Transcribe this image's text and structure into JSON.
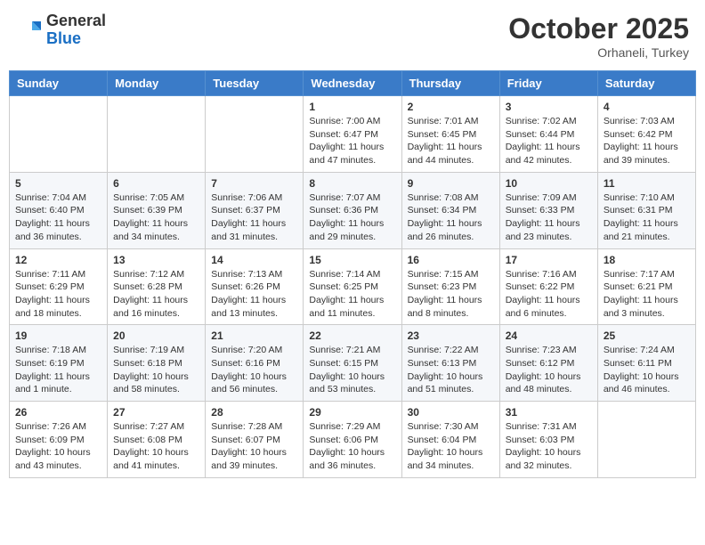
{
  "header": {
    "logo_general": "General",
    "logo_blue": "Blue",
    "month_title": "October 2025",
    "location": "Orhaneli, Turkey"
  },
  "days_of_week": [
    "Sunday",
    "Monday",
    "Tuesday",
    "Wednesday",
    "Thursday",
    "Friday",
    "Saturday"
  ],
  "weeks": [
    [
      {
        "day": "",
        "info": ""
      },
      {
        "day": "",
        "info": ""
      },
      {
        "day": "",
        "info": ""
      },
      {
        "day": "1",
        "info": "Sunrise: 7:00 AM\nSunset: 6:47 PM\nDaylight: 11 hours and 47 minutes."
      },
      {
        "day": "2",
        "info": "Sunrise: 7:01 AM\nSunset: 6:45 PM\nDaylight: 11 hours and 44 minutes."
      },
      {
        "day": "3",
        "info": "Sunrise: 7:02 AM\nSunset: 6:44 PM\nDaylight: 11 hours and 42 minutes."
      },
      {
        "day": "4",
        "info": "Sunrise: 7:03 AM\nSunset: 6:42 PM\nDaylight: 11 hours and 39 minutes."
      }
    ],
    [
      {
        "day": "5",
        "info": "Sunrise: 7:04 AM\nSunset: 6:40 PM\nDaylight: 11 hours and 36 minutes."
      },
      {
        "day": "6",
        "info": "Sunrise: 7:05 AM\nSunset: 6:39 PM\nDaylight: 11 hours and 34 minutes."
      },
      {
        "day": "7",
        "info": "Sunrise: 7:06 AM\nSunset: 6:37 PM\nDaylight: 11 hours and 31 minutes."
      },
      {
        "day": "8",
        "info": "Sunrise: 7:07 AM\nSunset: 6:36 PM\nDaylight: 11 hours and 29 minutes."
      },
      {
        "day": "9",
        "info": "Sunrise: 7:08 AM\nSunset: 6:34 PM\nDaylight: 11 hours and 26 minutes."
      },
      {
        "day": "10",
        "info": "Sunrise: 7:09 AM\nSunset: 6:33 PM\nDaylight: 11 hours and 23 minutes."
      },
      {
        "day": "11",
        "info": "Sunrise: 7:10 AM\nSunset: 6:31 PM\nDaylight: 11 hours and 21 minutes."
      }
    ],
    [
      {
        "day": "12",
        "info": "Sunrise: 7:11 AM\nSunset: 6:29 PM\nDaylight: 11 hours and 18 minutes."
      },
      {
        "day": "13",
        "info": "Sunrise: 7:12 AM\nSunset: 6:28 PM\nDaylight: 11 hours and 16 minutes."
      },
      {
        "day": "14",
        "info": "Sunrise: 7:13 AM\nSunset: 6:26 PM\nDaylight: 11 hours and 13 minutes."
      },
      {
        "day": "15",
        "info": "Sunrise: 7:14 AM\nSunset: 6:25 PM\nDaylight: 11 hours and 11 minutes."
      },
      {
        "day": "16",
        "info": "Sunrise: 7:15 AM\nSunset: 6:23 PM\nDaylight: 11 hours and 8 minutes."
      },
      {
        "day": "17",
        "info": "Sunrise: 7:16 AM\nSunset: 6:22 PM\nDaylight: 11 hours and 6 minutes."
      },
      {
        "day": "18",
        "info": "Sunrise: 7:17 AM\nSunset: 6:21 PM\nDaylight: 11 hours and 3 minutes."
      }
    ],
    [
      {
        "day": "19",
        "info": "Sunrise: 7:18 AM\nSunset: 6:19 PM\nDaylight: 11 hours and 1 minute."
      },
      {
        "day": "20",
        "info": "Sunrise: 7:19 AM\nSunset: 6:18 PM\nDaylight: 10 hours and 58 minutes."
      },
      {
        "day": "21",
        "info": "Sunrise: 7:20 AM\nSunset: 6:16 PM\nDaylight: 10 hours and 56 minutes."
      },
      {
        "day": "22",
        "info": "Sunrise: 7:21 AM\nSunset: 6:15 PM\nDaylight: 10 hours and 53 minutes."
      },
      {
        "day": "23",
        "info": "Sunrise: 7:22 AM\nSunset: 6:13 PM\nDaylight: 10 hours and 51 minutes."
      },
      {
        "day": "24",
        "info": "Sunrise: 7:23 AM\nSunset: 6:12 PM\nDaylight: 10 hours and 48 minutes."
      },
      {
        "day": "25",
        "info": "Sunrise: 7:24 AM\nSunset: 6:11 PM\nDaylight: 10 hours and 46 minutes."
      }
    ],
    [
      {
        "day": "26",
        "info": "Sunrise: 7:26 AM\nSunset: 6:09 PM\nDaylight: 10 hours and 43 minutes."
      },
      {
        "day": "27",
        "info": "Sunrise: 7:27 AM\nSunset: 6:08 PM\nDaylight: 10 hours and 41 minutes."
      },
      {
        "day": "28",
        "info": "Sunrise: 7:28 AM\nSunset: 6:07 PM\nDaylight: 10 hours and 39 minutes."
      },
      {
        "day": "29",
        "info": "Sunrise: 7:29 AM\nSunset: 6:06 PM\nDaylight: 10 hours and 36 minutes."
      },
      {
        "day": "30",
        "info": "Sunrise: 7:30 AM\nSunset: 6:04 PM\nDaylight: 10 hours and 34 minutes."
      },
      {
        "day": "31",
        "info": "Sunrise: 7:31 AM\nSunset: 6:03 PM\nDaylight: 10 hours and 32 minutes."
      },
      {
        "day": "",
        "info": ""
      }
    ]
  ]
}
